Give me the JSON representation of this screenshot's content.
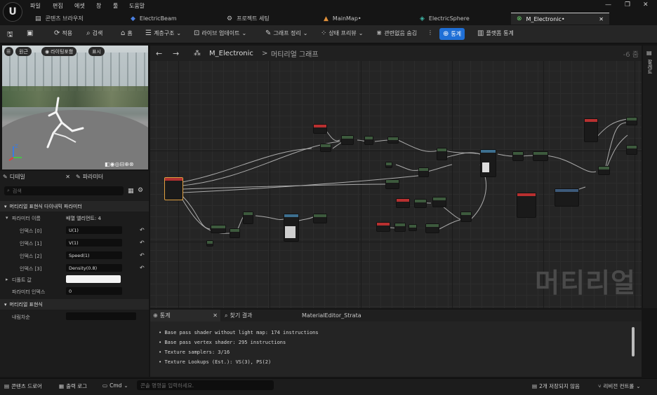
{
  "menu": {
    "items": [
      "파일",
      "편집",
      "에셋",
      "창",
      "툴",
      "도움말"
    ]
  },
  "tabs": [
    {
      "label": "콘텐츠 브라우저",
      "icon": "folder-icon"
    },
    {
      "label": "ElectricBeam",
      "icon": "niagara-icon"
    },
    {
      "label": "프로젝트 세팅",
      "icon": "gear-icon"
    },
    {
      "label": "MainMap•",
      "icon": "map-icon"
    },
    {
      "label": "ElectricSphere",
      "icon": "niagara-icon"
    },
    {
      "label": "M_Electronic•",
      "icon": "material-icon",
      "active": true
    }
  ],
  "toolbar": {
    "apply": "적용",
    "browse": "검색",
    "home": "홈",
    "hierarchy": "계층구조",
    "live_update": "라이브 업데이트",
    "clean_graph": "그래프 정리",
    "state_preview": "상태 프리뷰",
    "hide_unrelated": "관련없음 숨김",
    "stats": "통계",
    "platform_stats": "플랫폼 통계"
  },
  "viewport": {
    "pill1": "원근",
    "pill2": "라이팅포함",
    "pill3": "표시"
  },
  "details": {
    "tab1": "디테일",
    "tab2": "파라미터",
    "search_placeholder": "검색",
    "section1": "머티리얼 표현식 다이내믹 파라미터",
    "param_names_label": "파라미터 이름",
    "param_names_value": "배열 엘리먼트: 4",
    "rows": [
      {
        "label": "인덱스 [0]",
        "value": "U(1)"
      },
      {
        "label": "인덱스 [1]",
        "value": "V(1)"
      },
      {
        "label": "인덱스 [2]",
        "value": "Speed(1)"
      },
      {
        "label": "인덱스 [3]",
        "value": "Density(0.8)"
      }
    ],
    "default_label": "디폴트 값",
    "param_index_label": "파라미터 인덱스",
    "param_index_value": "0",
    "section2": "머티리얼 표현식",
    "desc_label": "내림차순"
  },
  "graph": {
    "back": "←",
    "forward": "→",
    "asset": "M_Electronic",
    "separator": ">",
    "breadcrumb": "머티리얼 그래프",
    "zoom": "-6 줌",
    "watermark": "머티리얼"
  },
  "right_strip": {
    "label": "팔레트"
  },
  "stats": {
    "tab": "통계",
    "find_tab": "찾기 결과",
    "strata_tab": "MaterialEditor_Strata",
    "lines": [
      "Base pass shader without light map: 174 instructions",
      "Base pass vertex shader: 295 instructions",
      "Texture samplers: 3/16",
      "Texture Lookups (Est.): VS(3), PS(2)"
    ]
  },
  "statusbar": {
    "content_drawer": "콘텐츠 드로어",
    "output_log": "출력 로그",
    "cmd": "Cmd",
    "cmd_placeholder": "콘솔 명령을 입력하세요.",
    "unsaved": "2개 저장되지 않음",
    "revision": "리비전 컨트롤"
  }
}
